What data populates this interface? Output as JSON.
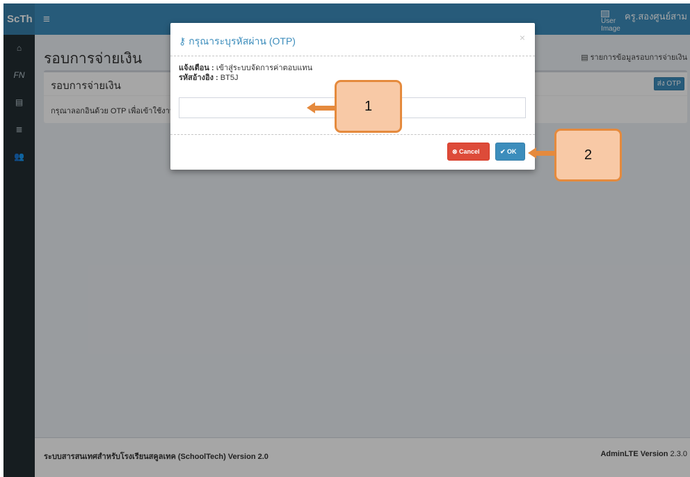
{
  "navbar": {
    "logo": "ScTh",
    "toggle_icon": "≡",
    "user_image_alt": "User Image",
    "user_name": "ครู.สองศูนย์สาม"
  },
  "sidebar": {
    "items": [
      {
        "icon": "home-icon",
        "glyph": "⌂"
      },
      {
        "icon": "fn-icon",
        "glyph": "FN"
      },
      {
        "icon": "document-icon",
        "glyph": "▤"
      },
      {
        "icon": "list-icon",
        "glyph": "≣"
      },
      {
        "icon": "users-icon",
        "glyph": "👥"
      }
    ]
  },
  "content": {
    "page_title": "รอบการจ่ายเงิน",
    "breadcrumb": "รายการข้อมูลรอบการจ่ายเงิน",
    "box_title": "รอบการจ่ายเงิน",
    "otp_button": "ส่ง OTP",
    "box_body": "กรุณาลอกอินด้วย OTP เพื่อเข้าใช้งาน"
  },
  "modal": {
    "title": "กรุณาระบุรหัสผ่าน (OTP)",
    "close": "×",
    "warning_label": "แจ้งเตือน :",
    "warning_text": "เข้าสู่ระบบจัดการค่าตอบแทน",
    "ref_label": "รหัสอ้างอิง :",
    "ref_value": "BT5J",
    "otp_value": "",
    "cancel_label": "Cancel",
    "ok_label": "OK"
  },
  "footer": {
    "left": "ระบบสารสนเทศสำหรับโรงเรียนสคูลเทค (SchoolTech) Version 2.0",
    "right_brand": "AdminLTE Version",
    "right_version": "2.3.0"
  },
  "callouts": {
    "one": "1",
    "two": "2"
  },
  "colors": {
    "primary": "#3c8dbc",
    "danger": "#dd4b39",
    "sidebar": "#222d32",
    "callout_fill": "#f8c9a6",
    "callout_border": "#e58a3d"
  }
}
